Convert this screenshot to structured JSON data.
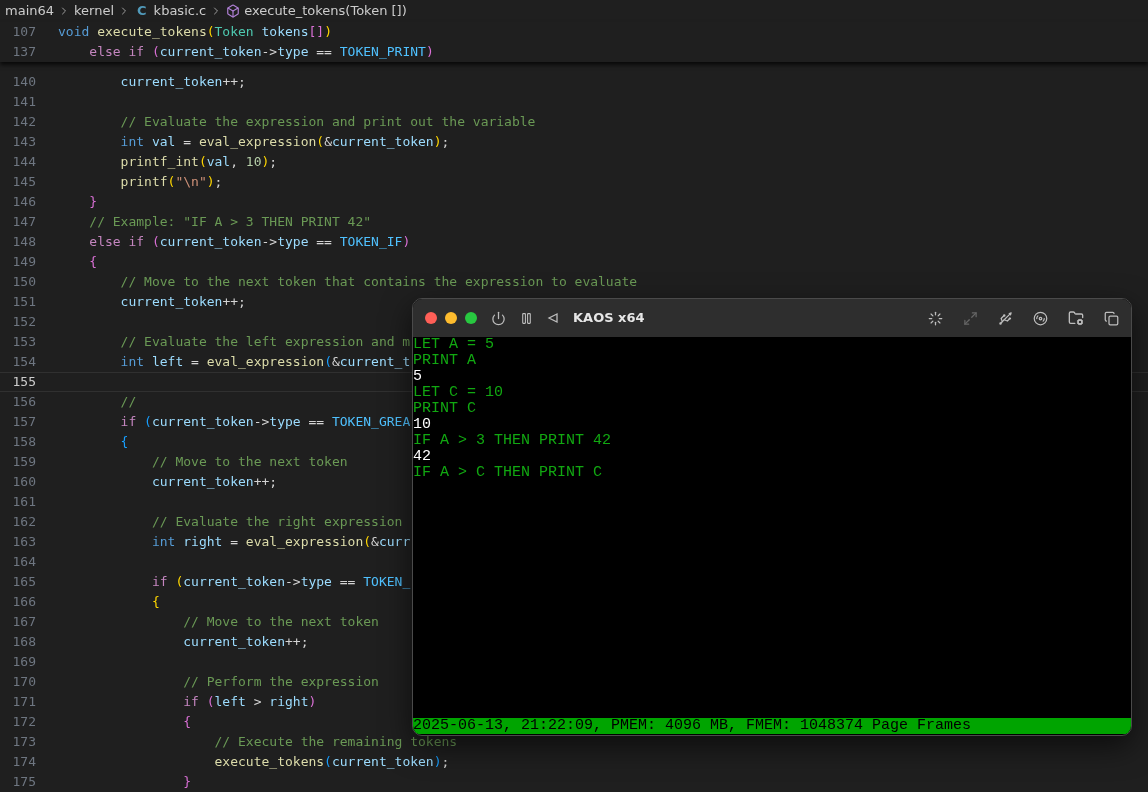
{
  "breadcrumb": {
    "folders": [
      "main64",
      "kernel"
    ],
    "file_icon_letter": "C",
    "file": "kbasic.c",
    "symbol": "execute_tokens(Token [])"
  },
  "sticky_lines": [
    {
      "number": "107",
      "tokens": [
        {
          "kind": "type",
          "text": "void "
        },
        {
          "kind": "function",
          "text": "execute_tokens"
        },
        {
          "kind": "bracket1",
          "text": "("
        },
        {
          "kind": "class",
          "text": "Token "
        },
        {
          "kind": "variable",
          "text": "tokens"
        },
        {
          "kind": "bracket2",
          "text": "[]"
        },
        {
          "kind": "bracket1",
          "text": ")"
        }
      ]
    },
    {
      "number": "137",
      "tokens": [
        {
          "kind": "keyword",
          "text": "    else if "
        },
        {
          "kind": "bracket2",
          "text": "("
        },
        {
          "kind": "variable",
          "text": "current_token"
        },
        {
          "kind": "plain",
          "text": "->"
        },
        {
          "kind": "variable",
          "text": "type"
        },
        {
          "kind": "plain",
          "text": " == "
        },
        {
          "kind": "constant",
          "text": "TOKEN_PRINT"
        },
        {
          "kind": "bracket2",
          "text": ")"
        }
      ]
    }
  ],
  "lines": [
    {
      "number": "140",
      "current": false,
      "tokens": [
        {
          "kind": "variable",
          "text": "        current_token"
        },
        {
          "kind": "plain",
          "text": "++;"
        }
      ]
    },
    {
      "number": "141",
      "current": false
    },
    {
      "number": "142",
      "current": false,
      "tokens": [
        {
          "kind": "comment",
          "text": "        // Evaluate the expression and print out the variable"
        }
      ]
    },
    {
      "number": "143",
      "current": false,
      "tokens": [
        {
          "kind": "type",
          "text": "        int "
        },
        {
          "kind": "variable",
          "text": "val"
        },
        {
          "kind": "plain",
          "text": " = "
        },
        {
          "kind": "function",
          "text": "eval_expression"
        },
        {
          "kind": "bracket1",
          "text": "("
        },
        {
          "kind": "plain",
          "text": "&"
        },
        {
          "kind": "variable",
          "text": "current_token"
        },
        {
          "kind": "bracket1",
          "text": ")"
        },
        {
          "kind": "plain",
          "text": ";"
        }
      ]
    },
    {
      "number": "144",
      "current": false,
      "tokens": [
        {
          "kind": "function",
          "text": "        printf_int"
        },
        {
          "kind": "bracket1",
          "text": "("
        },
        {
          "kind": "variable",
          "text": "val"
        },
        {
          "kind": "plain",
          "text": ", "
        },
        {
          "kind": "number",
          "text": "10"
        },
        {
          "kind": "bracket1",
          "text": ")"
        },
        {
          "kind": "plain",
          "text": ";"
        }
      ]
    },
    {
      "number": "145",
      "current": false,
      "tokens": [
        {
          "kind": "function",
          "text": "        printf"
        },
        {
          "kind": "bracket1",
          "text": "("
        },
        {
          "kind": "string",
          "text": "\"\\n\""
        },
        {
          "kind": "bracket1",
          "text": ")"
        },
        {
          "kind": "plain",
          "text": ";"
        }
      ]
    },
    {
      "number": "146",
      "current": false,
      "tokens": [
        {
          "kind": "bracket2",
          "text": "    }"
        }
      ]
    },
    {
      "number": "147",
      "current": false,
      "tokens": [
        {
          "kind": "comment",
          "text": "    // Example: \"IF A > 3 THEN PRINT 42\""
        }
      ]
    },
    {
      "number": "148",
      "current": false,
      "tokens": [
        {
          "kind": "keyword",
          "text": "    else if "
        },
        {
          "kind": "bracket2",
          "text": "("
        },
        {
          "kind": "variable",
          "text": "current_token"
        },
        {
          "kind": "plain",
          "text": "->"
        },
        {
          "kind": "variable",
          "text": "type"
        },
        {
          "kind": "plain",
          "text": " == "
        },
        {
          "kind": "constant",
          "text": "TOKEN_IF"
        },
        {
          "kind": "bracket2",
          "text": ")"
        }
      ]
    },
    {
      "number": "149",
      "current": false,
      "tokens": [
        {
          "kind": "bracket2",
          "text": "    {"
        }
      ]
    },
    {
      "number": "150",
      "current": false,
      "tokens": [
        {
          "kind": "comment",
          "text": "        // Move to the next token that contains the expression to evaluate"
        }
      ]
    },
    {
      "number": "151",
      "current": false,
      "tokens": [
        {
          "kind": "variable",
          "text": "        current_token"
        },
        {
          "kind": "plain",
          "text": "++;"
        }
      ]
    },
    {
      "number": "152",
      "current": false
    },
    {
      "number": "153",
      "current": false,
      "tokens": [
        {
          "kind": "comment",
          "text": "        // Evaluate the left expression and m"
        }
      ]
    },
    {
      "number": "154",
      "current": false,
      "tokens": [
        {
          "kind": "type",
          "text": "        int "
        },
        {
          "kind": "variable",
          "text": "left"
        },
        {
          "kind": "plain",
          "text": " = "
        },
        {
          "kind": "function",
          "text": "eval_expression"
        },
        {
          "kind": "bracket3",
          "text": "("
        },
        {
          "kind": "plain",
          "text": "&"
        },
        {
          "kind": "variable",
          "text": "current_t"
        }
      ]
    },
    {
      "number": "155",
      "current": true
    },
    {
      "number": "156",
      "current": false,
      "tokens": [
        {
          "kind": "comment",
          "text": "        //"
        }
      ]
    },
    {
      "number": "157",
      "current": false,
      "tokens": [
        {
          "kind": "keyword",
          "text": "        if "
        },
        {
          "kind": "bracket3",
          "text": "("
        },
        {
          "kind": "variable",
          "text": "current_token"
        },
        {
          "kind": "plain",
          "text": "->"
        },
        {
          "kind": "variable",
          "text": "type"
        },
        {
          "kind": "plain",
          "text": " == "
        },
        {
          "kind": "constant",
          "text": "TOKEN_GREA"
        }
      ]
    },
    {
      "number": "158",
      "current": false,
      "tokens": [
        {
          "kind": "bracket3",
          "text": "        {"
        }
      ]
    },
    {
      "number": "159",
      "current": false,
      "tokens": [
        {
          "kind": "comment",
          "text": "            // Move to the next token"
        }
      ]
    },
    {
      "number": "160",
      "current": false,
      "tokens": [
        {
          "kind": "variable",
          "text": "            current_token"
        },
        {
          "kind": "plain",
          "text": "++;"
        }
      ]
    },
    {
      "number": "161",
      "current": false
    },
    {
      "number": "162",
      "current": false,
      "tokens": [
        {
          "kind": "comment",
          "text": "            // Evaluate the right expression"
        }
      ]
    },
    {
      "number": "163",
      "current": false,
      "tokens": [
        {
          "kind": "type",
          "text": "            int "
        },
        {
          "kind": "variable",
          "text": "right"
        },
        {
          "kind": "plain",
          "text": " = "
        },
        {
          "kind": "function",
          "text": "eval_expression"
        },
        {
          "kind": "bracket1",
          "text": "("
        },
        {
          "kind": "plain",
          "text": "&"
        },
        {
          "kind": "variable",
          "text": "curr"
        }
      ]
    },
    {
      "number": "164",
      "current": false
    },
    {
      "number": "165",
      "current": false,
      "tokens": [
        {
          "kind": "keyword",
          "text": "            if "
        },
        {
          "kind": "bracket1",
          "text": "("
        },
        {
          "kind": "variable",
          "text": "current_token"
        },
        {
          "kind": "plain",
          "text": "->"
        },
        {
          "kind": "variable",
          "text": "type"
        },
        {
          "kind": "plain",
          "text": " == "
        },
        {
          "kind": "constant",
          "text": "TOKEN_"
        }
      ]
    },
    {
      "number": "166",
      "current": false,
      "tokens": [
        {
          "kind": "bracket1",
          "text": "            {"
        }
      ]
    },
    {
      "number": "167",
      "current": false,
      "tokens": [
        {
          "kind": "comment",
          "text": "                // Move to the next token"
        }
      ]
    },
    {
      "number": "168",
      "current": false,
      "tokens": [
        {
          "kind": "variable",
          "text": "                current_token"
        },
        {
          "kind": "plain",
          "text": "++;"
        }
      ]
    },
    {
      "number": "169",
      "current": false
    },
    {
      "number": "170",
      "current": false,
      "tokens": [
        {
          "kind": "comment",
          "text": "                // Perform the expression"
        }
      ]
    },
    {
      "number": "171",
      "current": false,
      "tokens": [
        {
          "kind": "keyword",
          "text": "                if "
        },
        {
          "kind": "bracket2",
          "text": "("
        },
        {
          "kind": "variable",
          "text": "left"
        },
        {
          "kind": "plain",
          "text": " > "
        },
        {
          "kind": "variable",
          "text": "right"
        },
        {
          "kind": "bracket2",
          "text": ")"
        }
      ]
    },
    {
      "number": "172",
      "current": false,
      "tokens": [
        {
          "kind": "bracket2",
          "text": "                {"
        }
      ]
    },
    {
      "number": "173",
      "current": false,
      "tokens": [
        {
          "kind": "comment",
          "text": "                    // Execute the remaining tokens"
        }
      ]
    },
    {
      "number": "174",
      "current": false,
      "tokens": [
        {
          "kind": "function",
          "text": "                    execute_tokens"
        },
        {
          "kind": "bracket3",
          "text": "("
        },
        {
          "kind": "variable",
          "text": "current_token"
        },
        {
          "kind": "bracket3",
          "text": ")"
        },
        {
          "kind": "plain",
          "text": ";"
        }
      ]
    },
    {
      "number": "175",
      "current": false,
      "tokens": [
        {
          "kind": "bracket2",
          "text": "                }"
        }
      ]
    }
  ],
  "vm_window": {
    "title": "KAOS x64",
    "terminal": [
      {
        "kind": "input",
        "text": "LET A = 5"
      },
      {
        "kind": "input",
        "text": "PRINT A"
      },
      {
        "kind": "output",
        "text": "5"
      },
      {
        "kind": "input",
        "text": "LET C = 10"
      },
      {
        "kind": "input",
        "text": "PRINT C"
      },
      {
        "kind": "output",
        "text": "10"
      },
      {
        "kind": "input",
        "text": "IF A > 3 THEN PRINT 42"
      },
      {
        "kind": "output",
        "text": "42"
      },
      {
        "kind": "input",
        "text": "IF A > C THEN PRINT C"
      }
    ],
    "status_line": "2025-06-13, 21:22:09, PMEM: 4096 MB, FMEM: 1048374 Page Frames"
  }
}
